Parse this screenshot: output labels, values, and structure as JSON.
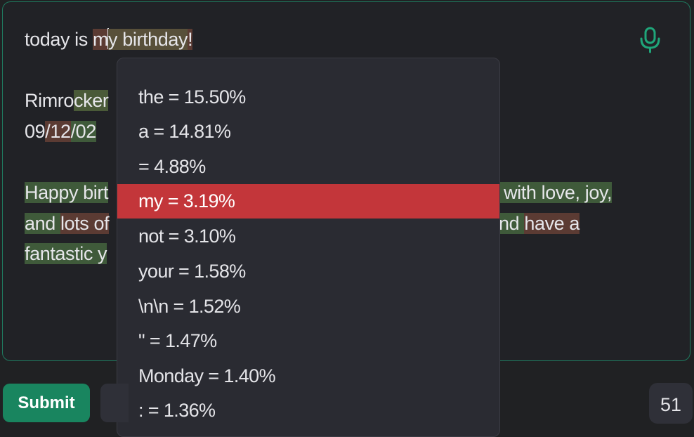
{
  "editor": {
    "line1": {
      "t1": "today is ",
      "t2": "m",
      "t3": "y",
      "t4": " birthday",
      "t5": "!"
    },
    "line2": {
      "t1": "Rimro",
      "t2": "cker"
    },
    "line3": {
      "t1": "09",
      "t2": "/12",
      "t3": "/02"
    },
    "line4": {
      "left": "Happy birt",
      "right": " with love, joy,"
    },
    "line5": {
      "left1": "and ",
      "left2": "lots of",
      "right1": "nd ",
      "right2": "have a"
    },
    "line6": {
      "left": "fantastic y"
    }
  },
  "mic_icon": "microphone-icon",
  "dropdown": {
    "options": [
      {
        "label": "the = 15.50%"
      },
      {
        "label": "a = 14.81%"
      },
      {
        "label": " = 4.88%"
      },
      {
        "label": "my = 3.19%"
      },
      {
        "label": "not = 3.10%"
      },
      {
        "label": "your = 1.58%"
      },
      {
        "label": "\\n\\n = 1.52%"
      },
      {
        "label": "\" = 1.47%"
      },
      {
        "label": "Monday = 1.40%"
      },
      {
        "label": ": = 1.36%"
      }
    ],
    "selected_index": 3
  },
  "footer": {
    "submit_label": "Submit",
    "token_count": "51"
  },
  "colors": {
    "accent": "#19855f",
    "selected": "#c3363a",
    "border": "#1f7a5f"
  }
}
